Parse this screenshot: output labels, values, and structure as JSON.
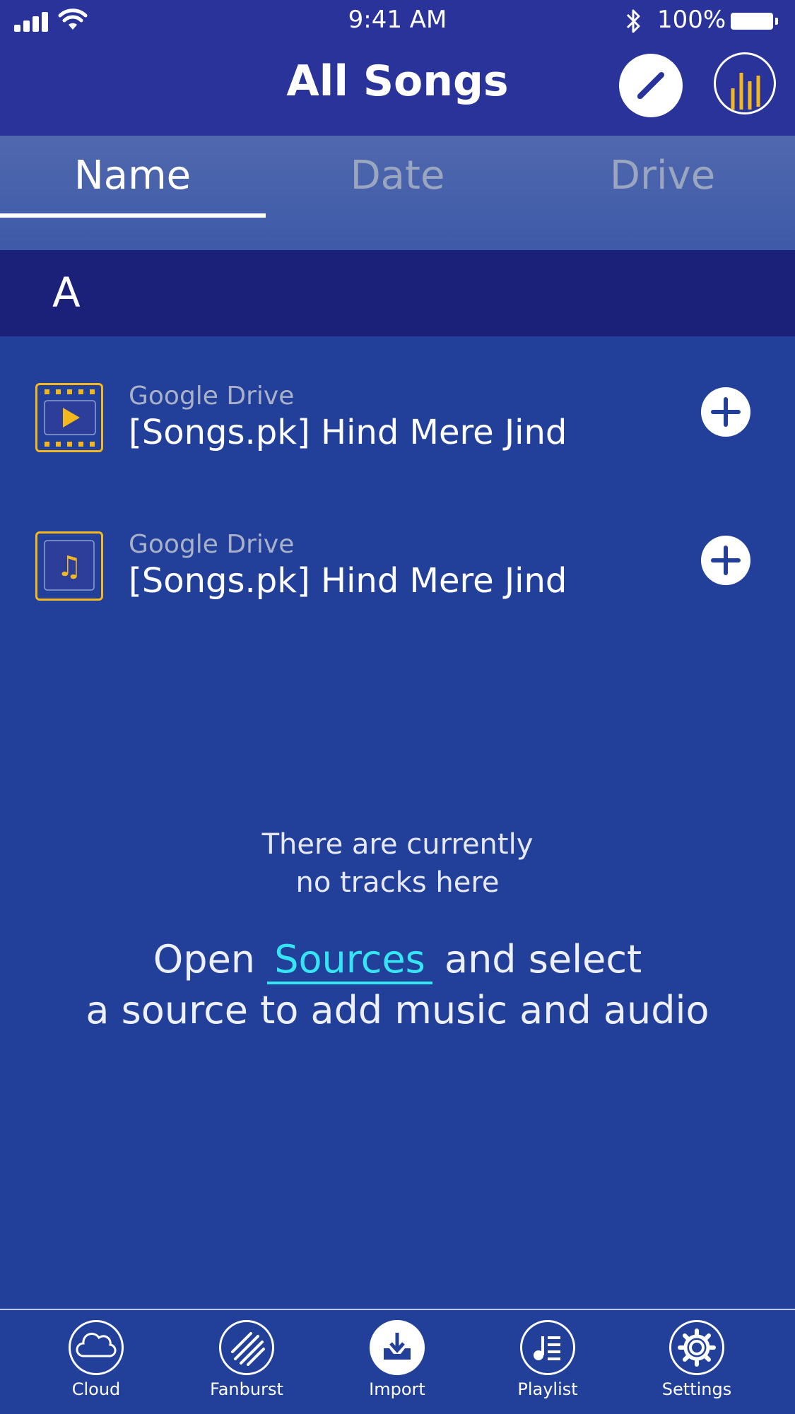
{
  "status_bar": {
    "time": "9:41 AM",
    "battery": "100%"
  },
  "header": {
    "title": "All Songs",
    "edit_icon": "pencil-icon",
    "equalizer_icon": "equalizer-icon"
  },
  "tabs": [
    {
      "label": "Name",
      "active": true
    },
    {
      "label": "Date",
      "active": false
    },
    {
      "label": "Drive",
      "active": false
    }
  ],
  "section": {
    "letter": "A"
  },
  "tracks": [
    {
      "source": "Google Drive",
      "title": "[Songs.pk] Hind Mere Jind",
      "icon": "video-file-icon"
    },
    {
      "source": "Google Drive",
      "title": "[Songs.pk] Hind Mere Jind",
      "icon": "music-file-icon"
    }
  ],
  "empty_state": {
    "line1": "There are currently",
    "line2": "no tracks here",
    "cta_open": "Open",
    "cta_link": "Sources",
    "cta_rest": "and select",
    "cta_line2": "a source to add music and audio"
  },
  "tab_bar": [
    {
      "label": "Cloud",
      "icon": "cloud-icon"
    },
    {
      "label": "Fanburst",
      "icon": "fanburst-icon"
    },
    {
      "label": "Import",
      "icon": "import-icon"
    },
    {
      "label": "Playlist",
      "icon": "playlist-icon"
    },
    {
      "label": "Settings",
      "icon": "gear-icon"
    }
  ],
  "colors": {
    "background": "#22409a",
    "header": "#29339a",
    "section": "#1b2079",
    "accent": "#f2b81e",
    "link": "#35e6f2"
  }
}
